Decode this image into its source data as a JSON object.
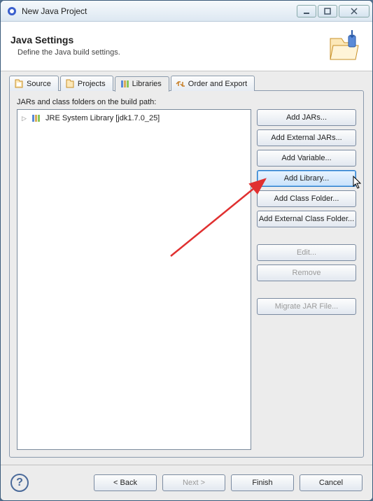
{
  "window": {
    "title": "New Java Project"
  },
  "header": {
    "title": "Java Settings",
    "subtitle": "Define the Java build settings."
  },
  "tabs": {
    "source": "Source",
    "projects": "Projects",
    "libraries": "Libraries",
    "order": "Order and Export"
  },
  "pathlabel": "JARs and class folders on the build path:",
  "tree": {
    "item0": "JRE System Library [jdk1.7.0_25]"
  },
  "buttons": {
    "add_jars": "Add JARs...",
    "add_ext_jars": "Add External JARs...",
    "add_variable": "Add Variable...",
    "add_library": "Add Library...",
    "add_class_folder": "Add Class Folder...",
    "add_ext_class_folder": "Add External Class Folder...",
    "edit": "Edit...",
    "remove": "Remove",
    "migrate": "Migrate JAR File..."
  },
  "footer": {
    "back": "< Back",
    "next": "Next >",
    "finish": "Finish",
    "cancel": "Cancel"
  }
}
